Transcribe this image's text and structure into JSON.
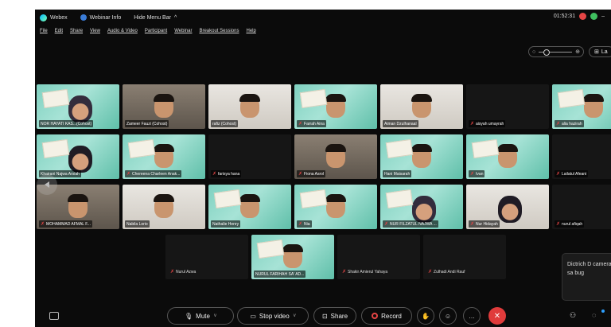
{
  "titlebar": {
    "app_name": "Webex",
    "webinar_info": "Webinar Info",
    "hide_menu": "Hide Menu Bar",
    "timer": "01:52:31"
  },
  "menu": [
    "File",
    "Edit",
    "Share",
    "View",
    "Audio & Video",
    "Participant",
    "Webinar",
    "Breakout Sessions",
    "Help"
  ],
  "toolbar_right": {
    "layout_label": "La"
  },
  "tooltip_text": "Dictrich D camera sa bug",
  "participants": [
    {
      "name": "NOR HAYATI KAS...(Cohost)",
      "muted": false,
      "style": "green"
    },
    {
      "name": "Zameer Fauzi (Cohost)",
      "muted": false,
      "style": "room"
    },
    {
      "name": "rafiz (Cohost)",
      "muted": false,
      "style": "light"
    },
    {
      "name": "Farrah Aina",
      "muted": true,
      "style": "green"
    },
    {
      "name": "Aiman Dzulhanaal",
      "muted": false,
      "style": "light"
    },
    {
      "name": "aisyah umayrah",
      "muted": true,
      "style": "dark"
    },
    {
      "name": "alia hazirah",
      "muted": true,
      "style": "green"
    },
    {
      "name": "Khairani Najwa Arsiah",
      "muted": false,
      "style": "green"
    },
    {
      "name": "Chereena Charleen Anak...",
      "muted": true,
      "style": "green"
    },
    {
      "name": "farisya hana",
      "muted": true,
      "style": "dark"
    },
    {
      "name": "Fiona Asrol",
      "muted": true,
      "style": "room"
    },
    {
      "name": "Hani Maisarah",
      "muted": false,
      "style": "green"
    },
    {
      "name": "Ivan",
      "muted": true,
      "style": "green"
    },
    {
      "name": "Lailatul Afeani",
      "muted": true,
      "style": "dark"
    },
    {
      "name": "MOHAMMAD AFMAL F...",
      "muted": true,
      "style": "room"
    },
    {
      "name": "Nabila Lorio",
      "muted": false,
      "style": "light"
    },
    {
      "name": "Nathalie Henry",
      "muted": false,
      "style": "green"
    },
    {
      "name": "Nia",
      "muted": true,
      "style": "green"
    },
    {
      "name": "NUR FILZATUL NAJWA ...",
      "muted": true,
      "style": "green"
    },
    {
      "name": "Nur Hidayah",
      "muted": true,
      "style": "light"
    },
    {
      "name": "nurul afiqah",
      "muted": true,
      "style": "dark"
    },
    {
      "name": "Nurul Azwa",
      "muted": true,
      "style": "dark"
    },
    {
      "name": "NURUL FARIHAH SA' AD...",
      "muted": false,
      "style": "green"
    },
    {
      "name": "Shakir Amierul Yahaya",
      "muted": true,
      "style": "dark"
    },
    {
      "name": "Zulhadi Andi Rauf",
      "muted": true,
      "style": "dark"
    }
  ],
  "controls": {
    "mute": "Mute",
    "stop_video": "Stop video",
    "share": "Share",
    "record": "Record"
  },
  "colors": {
    "accent_red": "#e64545",
    "tile_green": "#7fd1c0"
  }
}
